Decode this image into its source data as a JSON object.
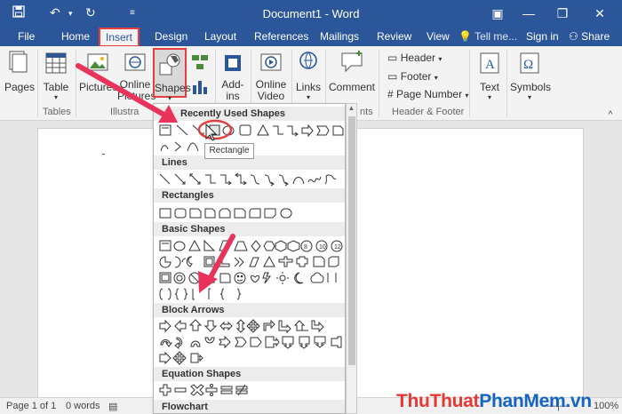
{
  "window": {
    "title": "Document1 - Word",
    "quick_access": [
      "save-icon",
      "undo-icon",
      "redo-icon",
      "customize-icon"
    ],
    "controls": [
      "ribbon-display-icon",
      "minimize-icon",
      "restore-icon",
      "close-icon"
    ]
  },
  "tabs": [
    {
      "label": "File"
    },
    {
      "label": "Home"
    },
    {
      "label": "Insert"
    },
    {
      "label": "Design"
    },
    {
      "label": "Layout"
    },
    {
      "label": "References"
    },
    {
      "label": "Mailings"
    },
    {
      "label": "Review"
    },
    {
      "label": "View"
    }
  ],
  "tell_me": "Tell me...",
  "sign_in": "Sign in",
  "share": "Share",
  "ribbon": {
    "pages": "Pages",
    "table": "Table",
    "pictures": "Pictures",
    "online_pictures_1": "Online",
    "online_pictures_2": "Pictures",
    "shapes": "Shapes",
    "addins_1": "Add-",
    "addins_2": "ins",
    "online_video_1": "Online",
    "online_video_2": "Video",
    "links": "Links",
    "comment": "Comment",
    "header": "Header",
    "footer": "Footer",
    "page_number": "Page Number",
    "text": "Text",
    "symbols": "Symbols",
    "groups": {
      "tables": "Tables",
      "illustrations": "Illustra",
      "comments_partial": "nts",
      "header_footer": "Header & Footer"
    }
  },
  "shapes_menu": {
    "recent": "Recently Used Shapes",
    "lines": "Lines",
    "rectangles": "Rectangles",
    "basic": "Basic Shapes",
    "block_arrows": "Block Arrows",
    "equation": "Equation Shapes",
    "flowchart": "Flowchart"
  },
  "tooltip": "Rectangle",
  "status": {
    "page": "Page 1 of 1",
    "words": "0 words",
    "zoom": "100%"
  },
  "watermark": {
    "part1": "ThuThuat",
    "part2": "PhanMem",
    "part3": ".vn"
  },
  "colors": {
    "accent": "#2b579a",
    "highlight": "#e53e3e",
    "arrow": "#e8335a"
  }
}
